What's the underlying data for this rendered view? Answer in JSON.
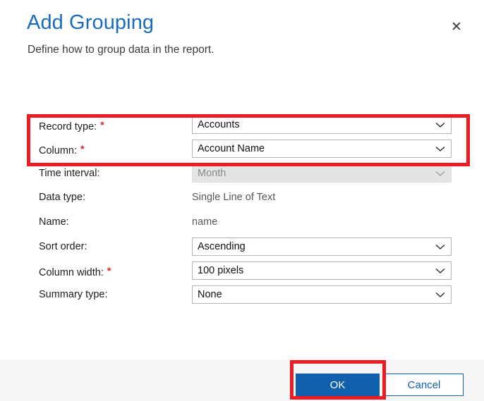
{
  "dialog": {
    "title": "Add Grouping",
    "subtitle": "Define how to group data in the report.",
    "close_icon": "close-icon"
  },
  "form": {
    "rows": [
      {
        "label": "Record type:",
        "required": "*",
        "control": "dropdown",
        "value": "Accounts",
        "disabled": false
      },
      {
        "label": "Column:",
        "required": "*",
        "control": "dropdown",
        "value": "Account Name",
        "disabled": false
      },
      {
        "label": "Time interval:",
        "required": "",
        "control": "dropdown",
        "value": "Month",
        "disabled": true
      },
      {
        "label": "Data type:",
        "required": "",
        "control": "text",
        "value": "Single Line of Text",
        "disabled": false
      },
      {
        "label": "Name:",
        "required": "",
        "control": "text",
        "value": "name",
        "disabled": false
      },
      {
        "label": "Sort order:",
        "required": "",
        "control": "dropdown",
        "value": "Ascending",
        "disabled": false
      },
      {
        "label": "Column width:",
        "required": "*",
        "control": "dropdown",
        "value": "100 pixels",
        "disabled": false
      },
      {
        "label": "Summary type:",
        "required": "",
        "control": "dropdown",
        "value": "None",
        "disabled": false
      }
    ]
  },
  "footer": {
    "ok_label": "OK",
    "cancel_label": "Cancel"
  },
  "annotations": {
    "color": "#ed1c24",
    "fields_highlight": "record-type-and-column-fields",
    "ok_highlight": "ok-button"
  },
  "colors": {
    "title_blue": "#1a6bbd",
    "primary_button": "#1160ae",
    "required_red": "#d62424",
    "annotation_red": "#ed1c24",
    "footer_background": "#f6f6f6",
    "disabled_field": "#e4e4e4"
  }
}
